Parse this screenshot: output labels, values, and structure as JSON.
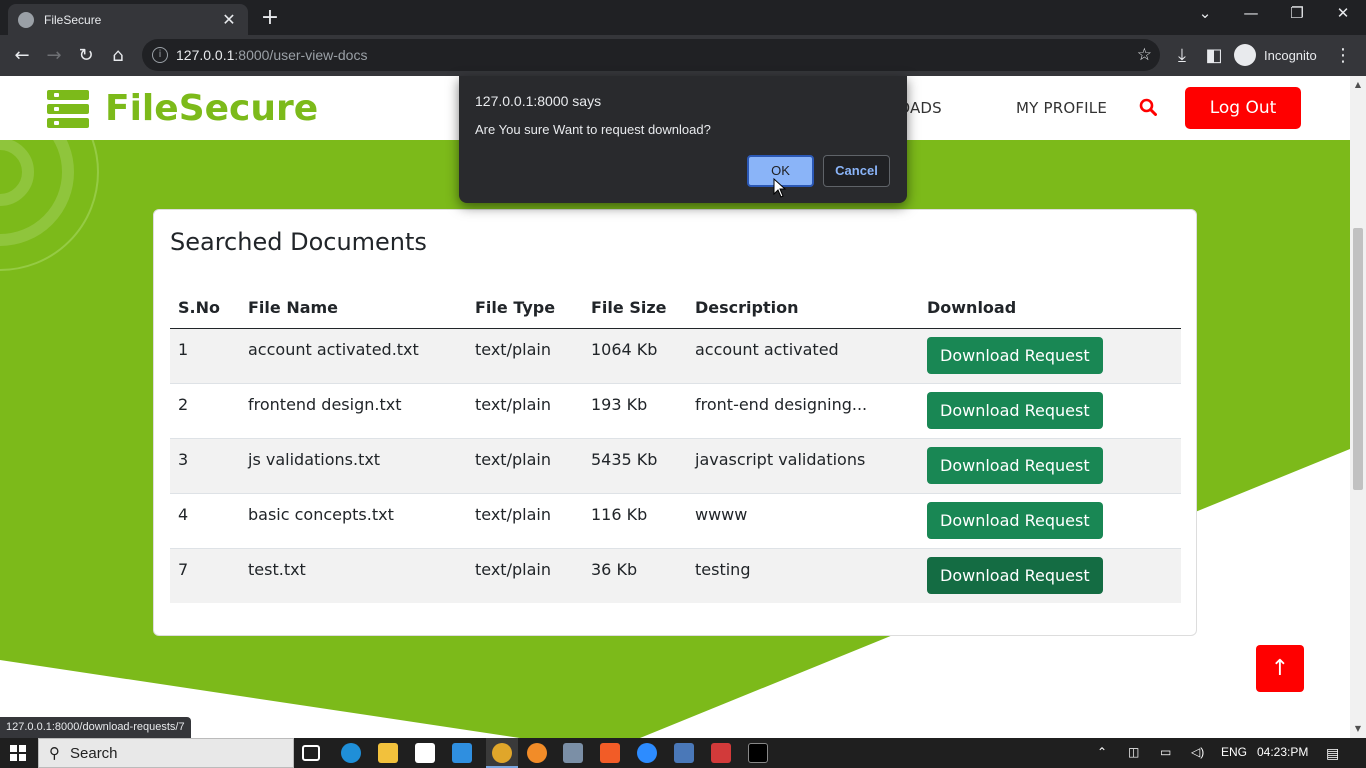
{
  "browser": {
    "tab_title": "FileSecure",
    "url_host": "127.0.0.1",
    "url_path": ":8000/user-view-docs",
    "incognito_label": "Incognito",
    "status_url": "127.0.0.1:8000/download-requests/7"
  },
  "header": {
    "logo_text": "FileSecure",
    "nav": [
      "DOWNLOADS",
      "MY PROFILE"
    ],
    "logout_label": "Log Out"
  },
  "card": {
    "title": "Searched Documents",
    "columns": [
      "S.No",
      "File Name",
      "File Type",
      "File Size",
      "Description",
      "Download"
    ],
    "rows": [
      {
        "sno": "1",
        "name": "account activated.txt",
        "type": "text/plain",
        "size": "1064 Kb",
        "desc": "account activated",
        "action": "Download Request"
      },
      {
        "sno": "2",
        "name": "frontend design.txt",
        "type": "text/plain",
        "size": "193 Kb",
        "desc": "front-end designing...",
        "action": "Download Request"
      },
      {
        "sno": "3",
        "name": "js validations.txt",
        "type": "text/plain",
        "size": "5435 Kb",
        "desc": "javascript validations",
        "action": "Download Request"
      },
      {
        "sno": "4",
        "name": "basic concepts.txt",
        "type": "text/plain",
        "size": "116 Kb",
        "desc": "wwww",
        "action": "Download Request"
      },
      {
        "sno": "7",
        "name": "test.txt",
        "type": "text/plain",
        "size": "36 Kb",
        "desc": "testing",
        "action": "Download Request"
      }
    ]
  },
  "dialog": {
    "title": "127.0.0.1:8000 says",
    "message": "Are You sure Want to request download?",
    "ok_label": "OK",
    "cancel_label": "Cancel"
  },
  "taskbar": {
    "search_label": "Search",
    "language": "ENG",
    "time": "04:23:PM"
  },
  "colors": {
    "brand_green": "#7cba1a",
    "button_green": "#198754",
    "logout_red": "#ff0000"
  },
  "icons": [
    "back-icon",
    "forward-icon",
    "reload-icon",
    "home-icon",
    "star-icon",
    "download-icon",
    "search-icon",
    "arrow-up-icon"
  ]
}
